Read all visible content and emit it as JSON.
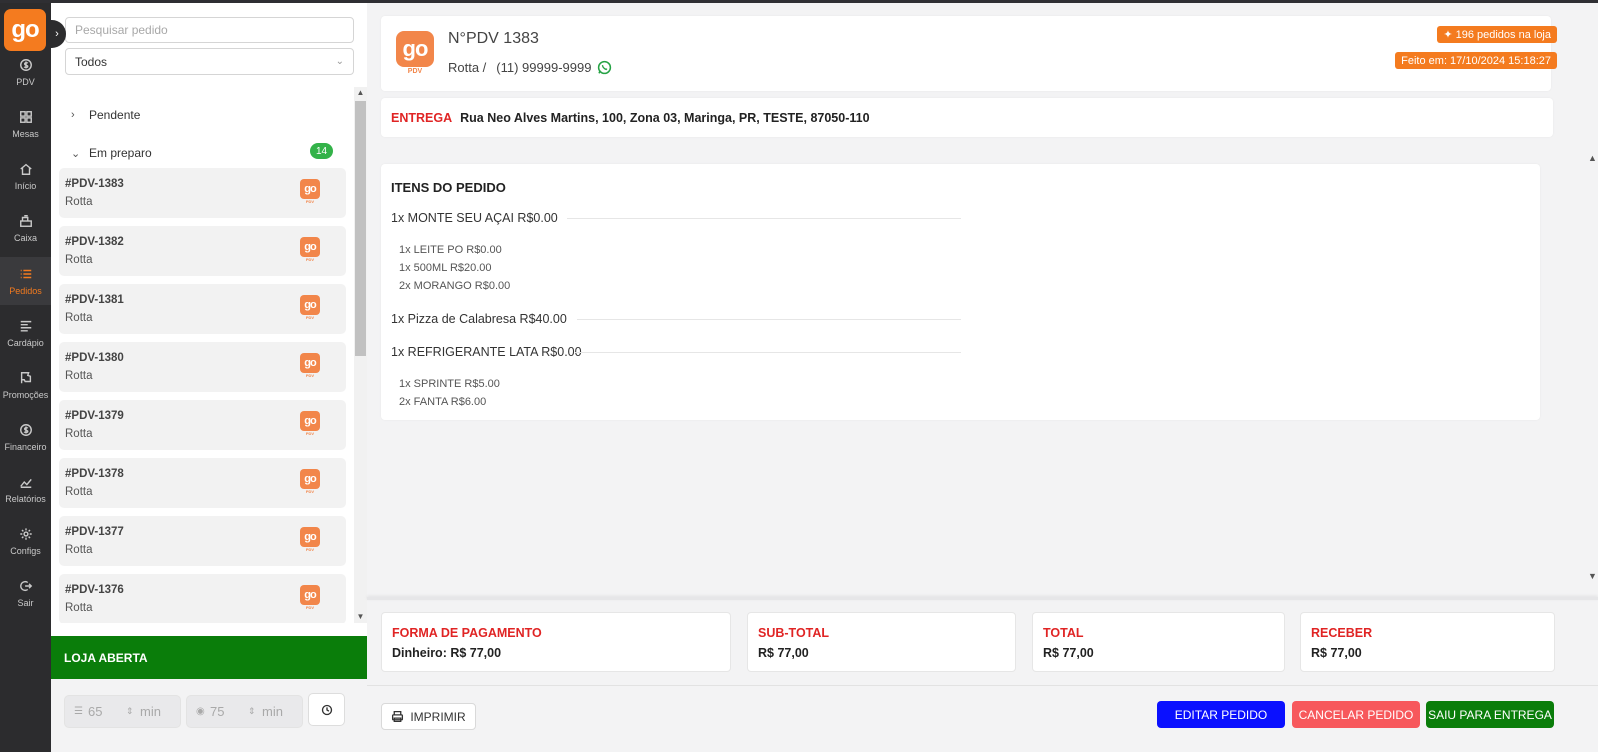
{
  "brand": {
    "logo_text": "go",
    "pdv_text": "PDV",
    "accent": "#f47b1f"
  },
  "nav": {
    "items": [
      {
        "label": "PDV",
        "icon": "dollar-circle-icon"
      },
      {
        "label": "Mesas",
        "icon": "grid-icon"
      },
      {
        "label": "Início",
        "icon": "home-icon"
      },
      {
        "label": "Caixa",
        "icon": "cash-register-icon"
      },
      {
        "label": "Pedidos",
        "icon": "list-icon",
        "active": true
      },
      {
        "label": "Cardápio",
        "icon": "menu-lines-icon"
      },
      {
        "label": "Promoções",
        "icon": "flag-icon"
      },
      {
        "label": "Financeiro",
        "icon": "dollar-circle-icon"
      },
      {
        "label": "Relatórios",
        "icon": "chart-line-icon"
      },
      {
        "label": "Configs",
        "icon": "gear-icon"
      },
      {
        "label": "Sair",
        "icon": "logout-icon"
      }
    ]
  },
  "panel": {
    "search_placeholder": "Pesquisar pedido",
    "filter_value": "Todos",
    "groups": [
      {
        "label": "Pendente",
        "expanded": false
      },
      {
        "label": "Em preparo",
        "expanded": true,
        "count": "14"
      }
    ],
    "orders": [
      {
        "num": "#PDV-1383",
        "customer": "Rotta"
      },
      {
        "num": "#PDV-1382",
        "customer": "Rotta"
      },
      {
        "num": "#PDV-1381",
        "customer": "Rotta"
      },
      {
        "num": "#PDV-1380",
        "customer": "Rotta"
      },
      {
        "num": "#PDV-1379",
        "customer": "Rotta"
      },
      {
        "num": "#PDV-1378",
        "customer": "Rotta"
      },
      {
        "num": "#PDV-1377",
        "customer": "Rotta"
      },
      {
        "num": "#PDV-1376",
        "customer": "Rotta"
      }
    ],
    "store_status": "LOJA ABERTA",
    "prep_time": {
      "value": "65",
      "unit": "min"
    },
    "delivery_time": {
      "value": "75",
      "unit": "min"
    }
  },
  "order": {
    "title": "N°PDV 1383",
    "customer": "Rotta /",
    "phone": "(11) 99999-9999",
    "store_orders": "✦ 196 pedidos na loja",
    "made_at": "Feito em: 17/10/2024 15:18:27",
    "delivery_label": "ENTREGA",
    "address": "Rua Neo Alves Martins, 100, Zona 03, Maringa, PR, TESTE, 87050-110",
    "items_title": "ITENS DO PEDIDO",
    "items": [
      {
        "text": "1x MONTE SEU AÇAI R$0.00",
        "subs": [
          "1x LEITE PO R$0.00",
          "1x 500ML R$20.00",
          "2x MORANGO R$0.00"
        ]
      },
      {
        "text": "1x Pizza de Calabresa R$40.00",
        "subs": []
      },
      {
        "text": "1x REFRIGERANTE LATA R$0.00",
        "subs": [
          "1x SPRINTE R$5.00",
          "2x FANTA R$6.00"
        ]
      }
    ]
  },
  "summary": {
    "payment_label": "FORMA DE PAGAMENTO",
    "payment_value": "Dinheiro: R$ 77,00",
    "subtotal_label": "SUB-TOTAL",
    "subtotal_value": "R$ 77,00",
    "total_label": "TOTAL",
    "total_value": "R$ 77,00",
    "receive_label": "RECEBER",
    "receive_value": "R$ 77,00"
  },
  "actions": {
    "print": "IMPRIMIR",
    "edit": "EDITAR PEDIDO",
    "cancel": "CANCELAR PEDIDO",
    "exit": "SAIU PARA ENTREGA"
  },
  "colors": {
    "red": "#e02424",
    "green": "#0a7d0a",
    "blue": "#0a10ff",
    "cancel": "#f7585c",
    "badge_green": "#33b249"
  }
}
